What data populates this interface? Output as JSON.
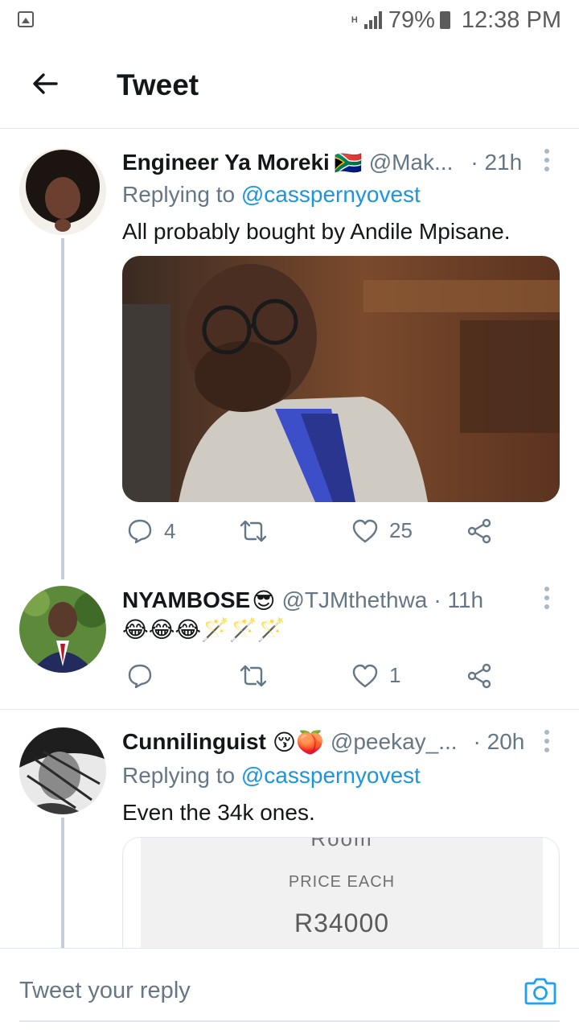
{
  "status_bar": {
    "battery": "79%",
    "time": "12:38 PM",
    "network": "H"
  },
  "header": {
    "title": "Tweet"
  },
  "tweets": [
    {
      "name": "Engineer Ya Moreki",
      "flag": "🇿🇦",
      "handle": "@Mak...",
      "time": "· 21h",
      "reply_prefix": "Replying to ",
      "reply_to": "@casspernyovest",
      "text": "All probably bought by Andile Mpisane.",
      "replies": "4",
      "retweets": "",
      "likes": "25"
    },
    {
      "name": "NYAMBOSE",
      "emoji": "😎",
      "handle": "@TJMthethwa",
      "time": "· 11h",
      "text": "😂😂😂🪄🪄🪄",
      "replies": "",
      "retweets": "",
      "likes": "1"
    },
    {
      "name": "Cunnilinguist",
      "emoji": "😚🍑",
      "handle": "@peekay_...",
      "time": "· 20h",
      "reply_prefix": "Replying to ",
      "reply_to": "@casspernyovest",
      "text": "Even the 34k ones."
    }
  ],
  "card": {
    "cut_text": "Room",
    "label": "PRICE EACH",
    "price": "R34000"
  },
  "compose": {
    "placeholder": "Tweet your reply"
  },
  "icons": [
    "back-arrow-icon",
    "more-vertical-icon",
    "reply-icon",
    "retweet-icon",
    "like-icon",
    "share-icon",
    "camera-icon"
  ],
  "colors": {
    "link": "#1b95e0",
    "secondary_text": "#657786",
    "thread_line": "#c4cfd6"
  }
}
